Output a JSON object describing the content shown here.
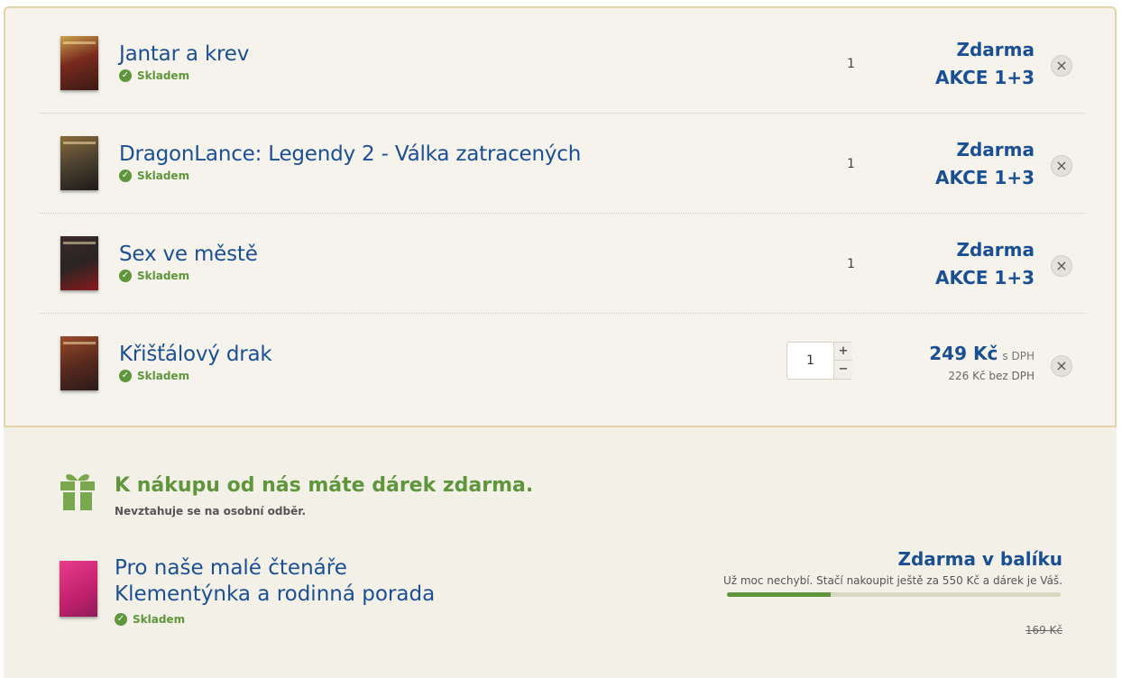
{
  "cart": {
    "items": [
      {
        "title": "Jantar a krev",
        "stock": "Skladem",
        "qty": "1",
        "price_line1": "Zdarma",
        "price_line2": "AKCE 1+3",
        "cover_color": "#7a2a1e"
      },
      {
        "title": "DragonLance: Legendy 2 - Válka zatracených",
        "stock": "Skladem",
        "qty": "1",
        "price_line1": "Zdarma",
        "price_line2": "AKCE 1+3",
        "cover_color": "#4a4030"
      },
      {
        "title": "Sex ve městě",
        "stock": "Skladem",
        "qty": "1",
        "price_line1": "Zdarma",
        "price_line2": "AKCE 1+3",
        "cover_color": "#2a2424"
      },
      {
        "title": "Křišťálový drak",
        "stock": "Skladem",
        "qty": "1",
        "price": "249 Kč",
        "price_unit": "s DPH",
        "price_without_vat": "226 Kč bez DPH",
        "cover_color": "#5a2a1e"
      }
    ],
    "stepper_plus": "+",
    "stepper_minus": "−",
    "remove_symbol": "×"
  },
  "gift": {
    "heading": "K nákupu od nás máte dárek zdarma.",
    "note": "Nevztahuje se na osobní odběr.",
    "title_line1": "Pro naše malé čtenáře",
    "title_line2": "Klementýnka a rodinná porada",
    "stock": "Skladem",
    "free_label": "Zdarma v balíku",
    "hint": "Už moc nechybí. Stačí nakoupit ještě za 550 Kč a dárek je Váš.",
    "progress_fraction": 0.31,
    "old_price": "169 Kč"
  },
  "colors": {
    "accent_blue": "#1b4f94",
    "accent_green": "#5f963b",
    "border": "#e5d3a8"
  }
}
